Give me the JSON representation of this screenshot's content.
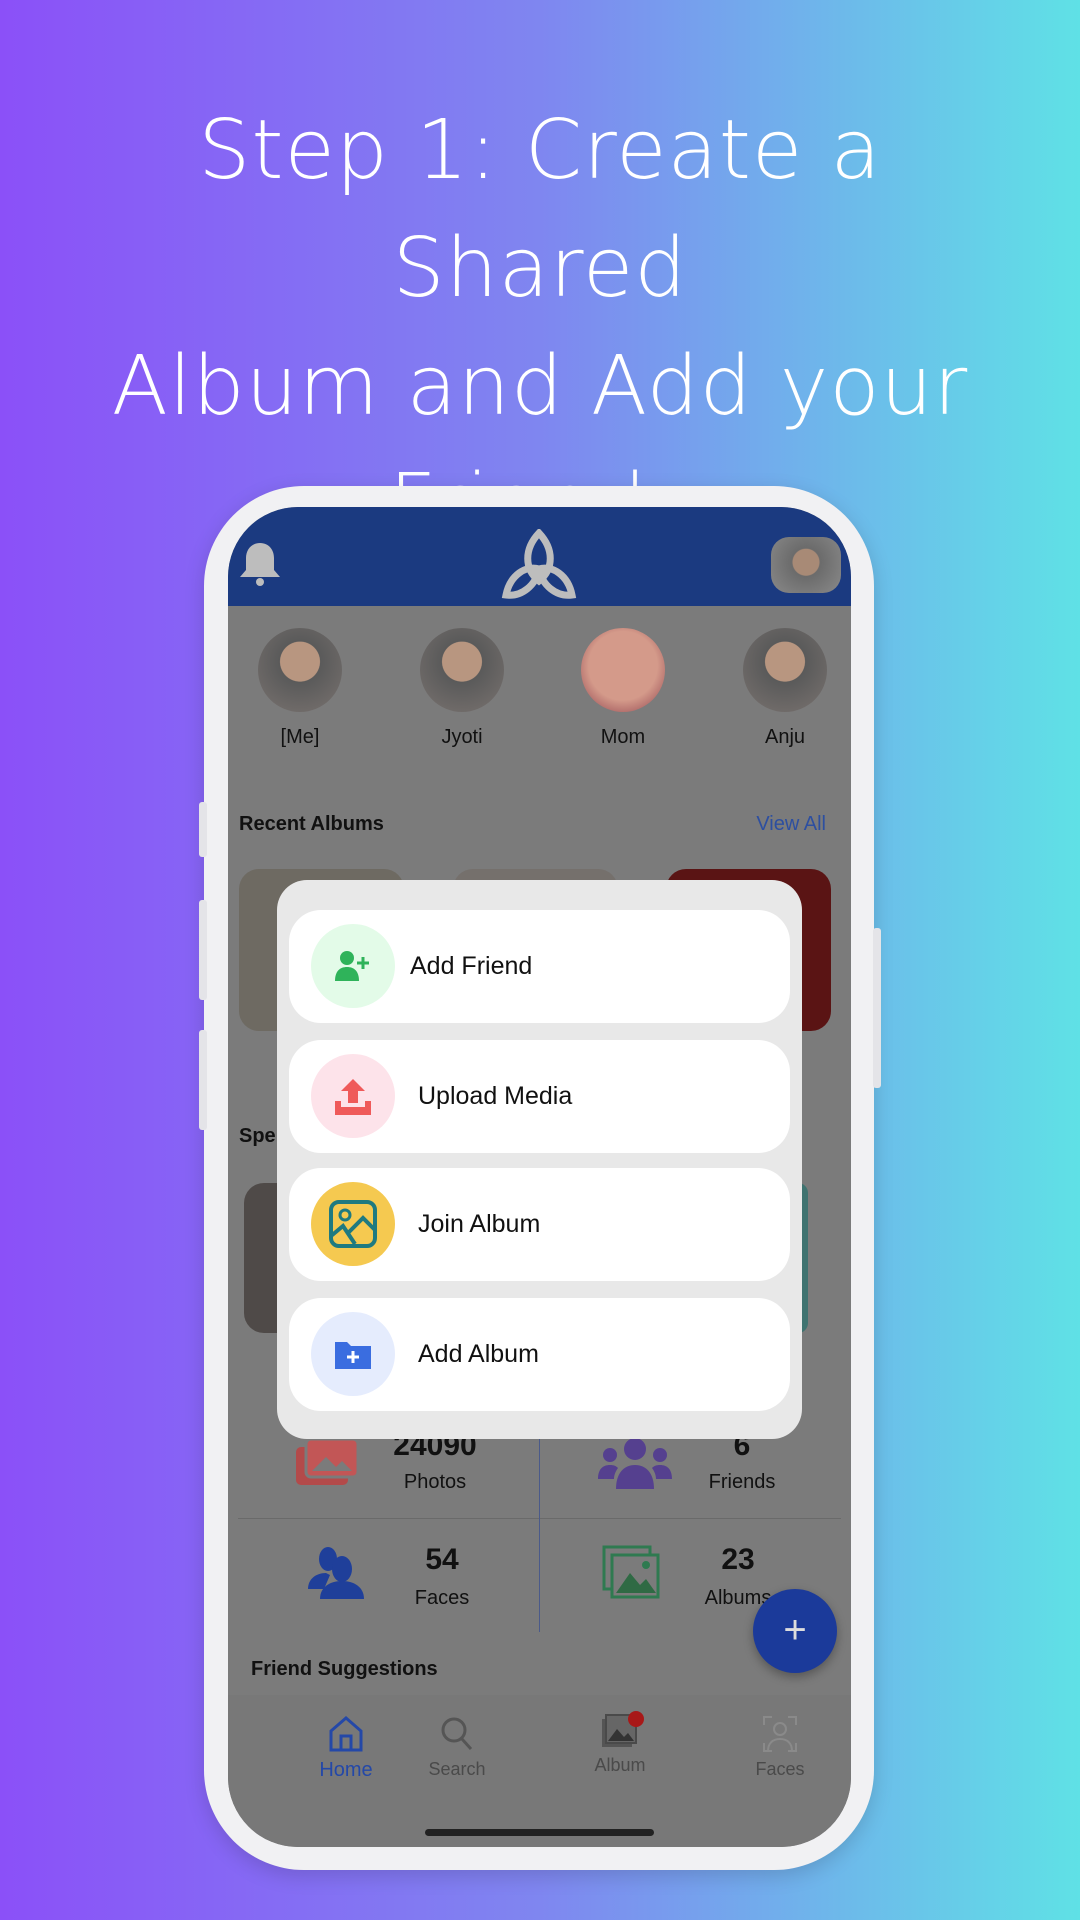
{
  "headline": {
    "line1": "Step 1: Create a Shared",
    "line2": "Album and Add your",
    "line3": "Friends"
  },
  "colors": {
    "header": "#1b3a80",
    "accent": "#2d4fa0",
    "fab": "#1b3a9a",
    "background_left": "#8b50f8",
    "background_right": "#5fe1e6"
  },
  "app": {
    "header": {
      "left_icon": "bell-icon",
      "logo": "trinity-knot-logo",
      "right_icon": "profile-avatar"
    },
    "people": [
      {
        "name": "[Me]"
      },
      {
        "name": "Jyoti"
      },
      {
        "name": "Mom"
      },
      {
        "name": "Anju"
      }
    ],
    "recent_albums": {
      "title": "Recent Albums",
      "view_all": "View All"
    },
    "special_section_partial": "Spe",
    "stats": [
      {
        "value": "24090",
        "label": "Photos",
        "icon": "photos-icon"
      },
      {
        "value": "6",
        "label": "Friends",
        "icon": "friends-icon"
      },
      {
        "value": "54",
        "label": "Faces",
        "icon": "faces-icon"
      },
      {
        "value": "23",
        "label": "Albums",
        "icon": "albums-icon"
      }
    ],
    "friend_suggestions": "Friend Suggestions",
    "fab": "+",
    "nav": [
      {
        "label": "Home",
        "icon": "home-icon",
        "active": true
      },
      {
        "label": "Search",
        "icon": "search-icon"
      },
      {
        "label": "Album",
        "icon": "album-icon",
        "badge": true
      },
      {
        "label": "Faces",
        "icon": "face-scan-icon"
      }
    ]
  },
  "menu": {
    "items": [
      {
        "label": "Add Friend",
        "icon": "add-user-icon",
        "icon_bg": "#e3fbe8",
        "icon_color": "#2fb35a"
      },
      {
        "label": "Upload Media",
        "icon": "upload-icon",
        "icon_bg": "#fde3ea",
        "icon_color": "#ef5a5a"
      },
      {
        "label": "Join Album",
        "icon": "image-icon",
        "icon_bg": "#f5c950",
        "icon_color": "#1f7a80"
      },
      {
        "label": "Add Album",
        "icon": "folder-plus-icon",
        "icon_bg": "#e5ecfd",
        "icon_color": "#3a6de0"
      }
    ]
  }
}
